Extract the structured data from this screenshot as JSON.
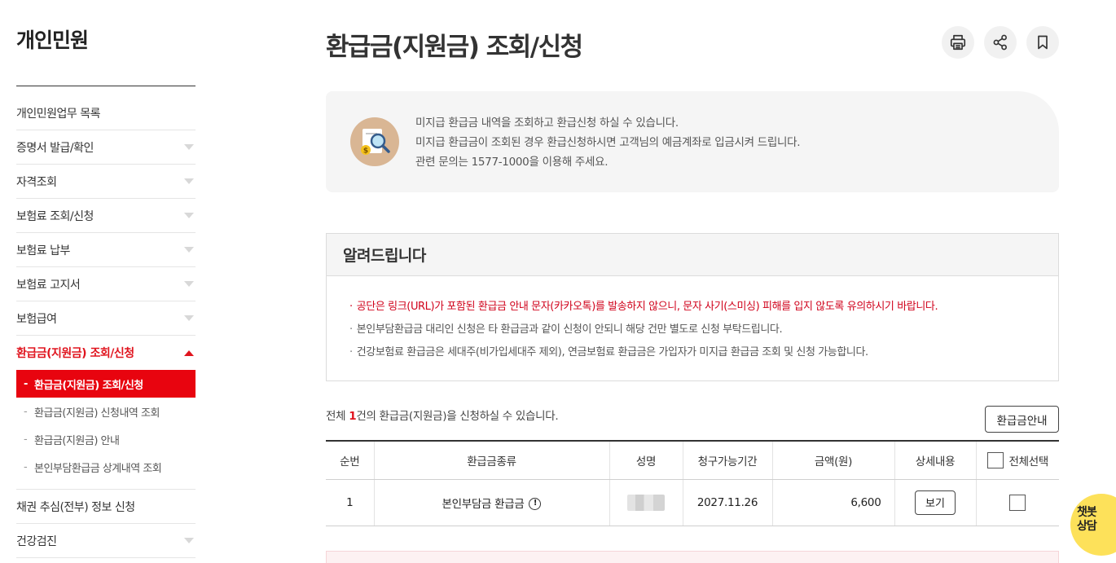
{
  "sidebar": {
    "title": "개인민원",
    "items": [
      {
        "label": "개인민원업무 목록",
        "caret": false
      },
      {
        "label": "증명서 발급/확인",
        "caret": true
      },
      {
        "label": "자격조회",
        "caret": true
      },
      {
        "label": "보험료 조회/신청",
        "caret": true
      },
      {
        "label": "보험료 납부",
        "caret": true
      },
      {
        "label": "보험료 고지서",
        "caret": true
      },
      {
        "label": "보험급여",
        "caret": true
      },
      {
        "label": "환급금(지원금) 조회/신청",
        "caret": true,
        "active": true
      }
    ],
    "sub_items": [
      {
        "label": "환급금(지원금) 조회/신청",
        "current": true
      },
      {
        "label": "환급금(지원금) 신청내역 조회"
      },
      {
        "label": "환급금(지원금) 안내"
      },
      {
        "label": "본인부담환급금 상계내역 조회"
      }
    ],
    "items_after": [
      {
        "label": "채권 추심(전부) 정보 신청",
        "caret": false
      },
      {
        "label": "건강검진",
        "caret": true
      }
    ],
    "sub_dash": "-"
  },
  "page": {
    "title": "환급금(지원금) 조회/신청",
    "tools": [
      "print-icon",
      "share-icon",
      "bookmark-icon"
    ]
  },
  "info": {
    "icon": "magnifier-document-icon",
    "lines": [
      "미지급 환급금 내역을 조회하고 환급신청 하실 수 있습니다.",
      "미지급 환급금이 조회된 경우 환급신청하시면 고객님의 예금계좌로 입금시켜 드립니다.",
      "관련 문의는 1577-1000을 이용해 주세요."
    ]
  },
  "notice": {
    "title": "알려드립니다",
    "items": [
      {
        "text": "공단은 링크(URL)가 포함된 환급금 안내 문자(카카오톡)를 발송하지 않으니, 문자 사기(스미싱) 피해를 입지 않도록 유의하시기 바랍니다.",
        "highlight": true
      },
      {
        "text": "본인부담환급금 대리인 신청은 타 환급금과 같이 신청이 안되니 해당 건만 별도로 신청 부탁드립니다.",
        "highlight": false
      },
      {
        "text": "건강보험료 환급금은 세대주(비가입세대주 제외), 연금보험료 환급금은 가입자가 미지급 환급금 조회 및 신청 가능합니다.",
        "highlight": false
      }
    ]
  },
  "summary": {
    "prefix": "전체 ",
    "count": "1",
    "suffix": "건의 환급금(지원금)을 신청하실 수 있습니다.",
    "guide_button": "환급금안내"
  },
  "table": {
    "headers": {
      "no": "순번",
      "type": "환급금종류",
      "name": "성명",
      "period": "청구가능기간",
      "amount": "금액(원)",
      "detail": "상세내용",
      "select_all": "전체선택"
    },
    "rows": [
      {
        "no": "1",
        "type": "본인부담금 환급금",
        "info_icon": "!",
        "name_masked": true,
        "period": "2027.11.26",
        "amount": "6,600",
        "detail_button": "보기"
      }
    ]
  },
  "chatbot": {
    "line1": "챗봇",
    "line2": "상담",
    "color": "#fde15a"
  },
  "colors": {
    "accent": "#e0141e",
    "highlight_text": "#d0021b",
    "current_bg": "#e8040f"
  }
}
